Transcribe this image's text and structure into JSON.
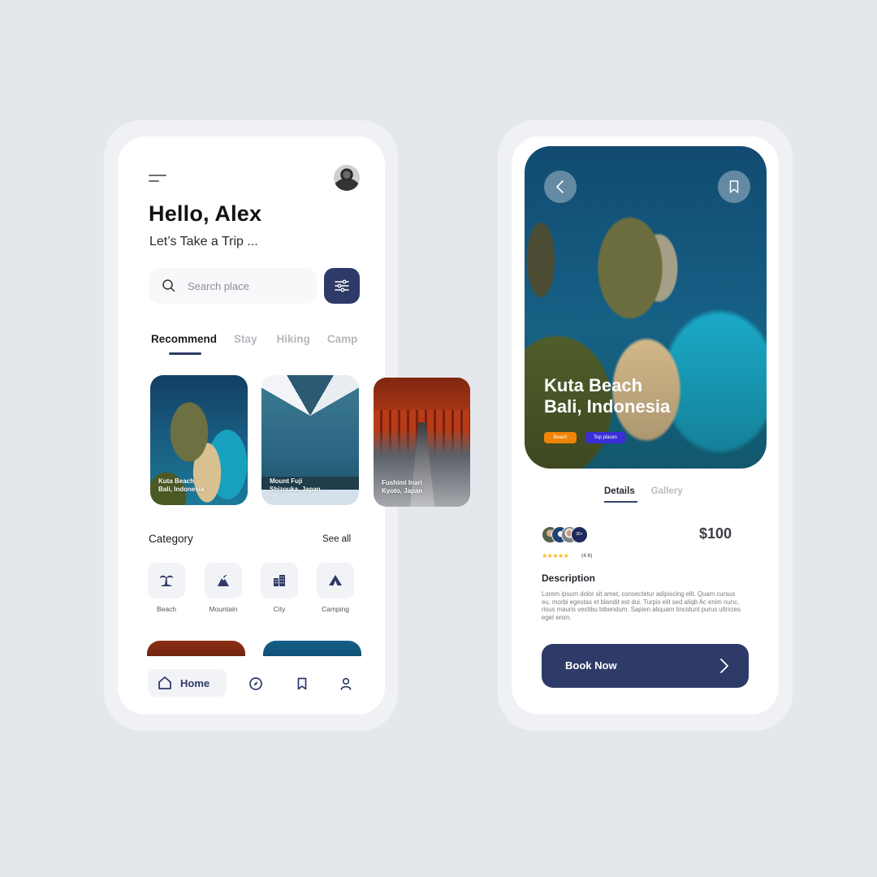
{
  "home_screen": {
    "greeting": "Hello, Alex",
    "subgreeting": "Let’s Take a Trip ...",
    "search": {
      "placeholder": "Search place",
      "value": ""
    },
    "tabs": [
      {
        "label": "Recommend",
        "active": true
      },
      {
        "label": "Stay",
        "active": false
      },
      {
        "label": "Hiking",
        "active": false
      },
      {
        "label": "Camp",
        "active": false
      }
    ],
    "cards": [
      {
        "name": "Kuta Beach",
        "location": "Bali, Indonesia"
      },
      {
        "name": "Mount Fuji",
        "location": "Shizouka, Japan"
      },
      {
        "name": "Fushimi Inari",
        "location": "Kyoto, Japan"
      }
    ],
    "category": {
      "title": "Category",
      "see_all": "See all",
      "items": [
        {
          "label": "Beach",
          "icon": "palm-tree-icon"
        },
        {
          "label": "Mountain",
          "icon": "mountain-icon"
        },
        {
          "label": "City",
          "icon": "city-icon"
        },
        {
          "label": "Camping",
          "icon": "tent-icon"
        }
      ]
    },
    "bottom_nav": {
      "home_label": "Home",
      "items": [
        "home-icon",
        "compass-icon",
        "bookmark-icon",
        "user-icon"
      ]
    }
  },
  "detail_screen": {
    "title_line1": "Kuta Beach",
    "title_line2": "Bali, Indonesia",
    "tags": [
      "Beach",
      "Top places"
    ],
    "tabs": [
      {
        "label": "Details",
        "active": true
      },
      {
        "label": "Gallery",
        "active": false
      }
    ],
    "visitors_more": "30+",
    "stars": "★★★★★",
    "rating_value": 4.6,
    "rating_text": "(4.6)",
    "price": "$100",
    "description_title": "Description",
    "description": "Lorem ipsum dolor sit amet, consectetur adipiscing elit. Quam cursus eu, morbi egestas et blandit est dui. Turpis elit sed aliqb Ac enim nunc, risus mauris vestibu bibendum. Sapien aliquam tincidunt purus ultricies eget enim.",
    "book_button": "Book Now"
  },
  "colors": {
    "background": "#e4e7ec",
    "primary": "#2e3a67",
    "tag_beach": "#ef8407",
    "tag_top": "#3a2ed6",
    "star": "#f5b71b"
  }
}
